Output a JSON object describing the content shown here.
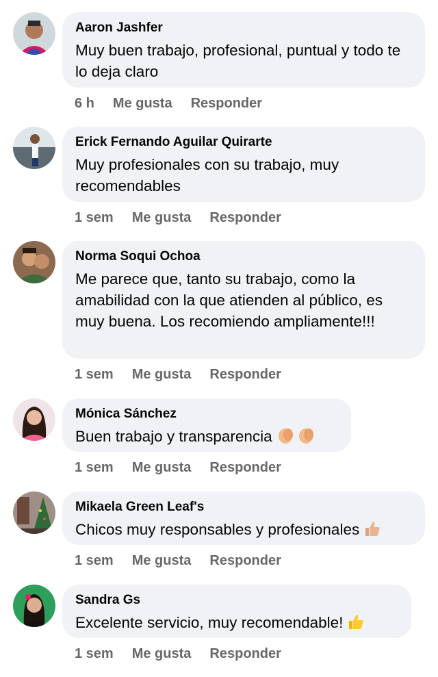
{
  "comments": [
    {
      "author": "Aaron Jashfer",
      "text": "Muy buen trabajo, profesional, puntual y todo te lo deja claro",
      "time": "6 h",
      "like": "Me gusta",
      "reply": "Responder",
      "avatar": "avatar-aaron",
      "emoji": ""
    },
    {
      "author": "Erick Fernando Aguilar Quirarte",
      "text": "Muy profesionales con su trabajo, muy recomendables",
      "time": "1 sem",
      "like": "Me gusta",
      "reply": "Responder",
      "avatar": "avatar-erick",
      "emoji": ""
    },
    {
      "author": "Norma Soqui Ochoa",
      "text": "Me parece que, tanto su trabajo, como la amabilidad con la que atienden al público, es muy buena. Los recomiendo ampliamente!!!",
      "time": "1 sem",
      "like": "Me gusta",
      "reply": "Responder",
      "avatar": "avatar-norma",
      "emoji": ""
    },
    {
      "author": "Mónica Sánchez",
      "text": "Buen trabajo y transparencia",
      "time": "1 sem",
      "like": "Me gusta",
      "reply": "Responder",
      "avatar": "avatar-monica",
      "emoji": "clapping-hands-icon"
    },
    {
      "author": "Mikaela Green Leaf's",
      "text": "Chicos muy responsables y profesionales",
      "time": "1 sem",
      "like": "Me gusta",
      "reply": "Responder",
      "avatar": "avatar-mikaela",
      "emoji": "thumbs-up-icon"
    },
    {
      "author": "Sandra Gs",
      "text": "Excelente servicio, muy recomendable!",
      "time": "1 sem",
      "like": "Me gusta",
      "reply": "Responder",
      "avatar": "avatar-sandra",
      "emoji": "thumbs-up-icon"
    }
  ],
  "colors": {
    "bubble": "#f0f2f5",
    "meta": "#65676b",
    "text": "#050505"
  }
}
